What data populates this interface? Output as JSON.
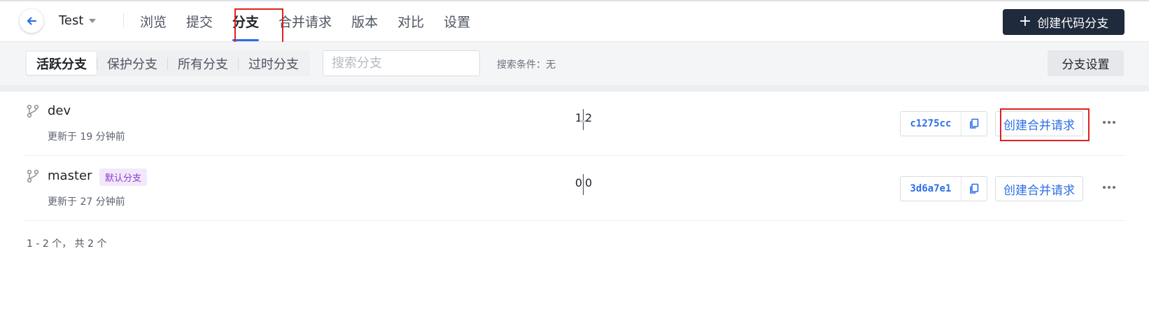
{
  "header": {
    "repo_name": "Test",
    "tabs": [
      {
        "label": "浏览"
      },
      {
        "label": "提交"
      },
      {
        "label": "分支"
      },
      {
        "label": "合并请求"
      },
      {
        "label": "版本"
      },
      {
        "label": "对比"
      },
      {
        "label": "设置"
      }
    ],
    "active_tab": "分支",
    "create_branch_label": "创建代码分支"
  },
  "filters": {
    "segments": [
      {
        "label": "活跃分支"
      },
      {
        "label": "保护分支"
      },
      {
        "label": "所有分支"
      },
      {
        "label": "过时分支"
      }
    ],
    "selected": "活跃分支",
    "search_placeholder": "搜索分支",
    "search_value": "",
    "condition_text": "搜索条件：无",
    "settings_label": "分支设置"
  },
  "branches": [
    {
      "name": "dev",
      "badge": "",
      "updated": "更新于 19 分钟前",
      "behind": "1",
      "ahead": "2",
      "sha": "c1275cc",
      "mr_label": "创建合并请求"
    },
    {
      "name": "master",
      "badge": "默认分支",
      "updated": "更新于 27 分钟前",
      "behind": "0",
      "ahead": "0",
      "sha": "3d6a7e1",
      "mr_label": "创建合并请求"
    }
  ],
  "pagination": {
    "text": "1 - 2 个， 共 2 个"
  },
  "colors": {
    "accent": "#2b6ee6",
    "primary_button": "#1f2a3d",
    "highlight": "#e02020",
    "badge_bg": "#f3e8fb",
    "badge_text": "#8a3bd0"
  },
  "icons": {
    "back": "arrow-left-icon",
    "caret": "chevron-down-icon",
    "search": "search-icon",
    "branch": "branch-icon",
    "copy": "copy-icon",
    "more": "more-horizontal-icon"
  }
}
